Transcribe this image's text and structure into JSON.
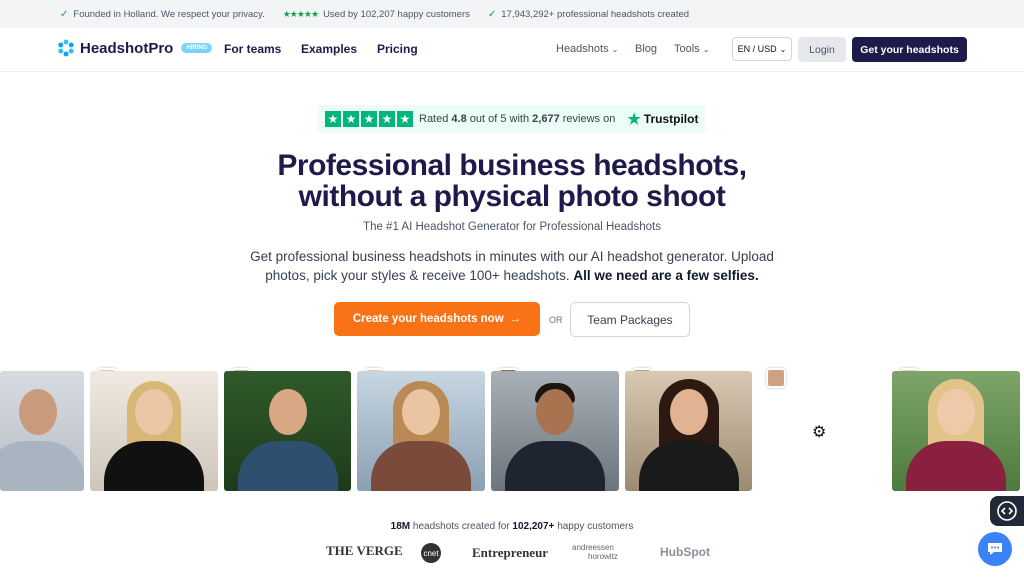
{
  "topbar": {
    "founded": "Founded in Holland. We respect your privacy.",
    "stars": "★★★★★",
    "used_by": "Used by 102,207 happy customers",
    "created": "17,943,292+ professional headshots created"
  },
  "nav": {
    "logo": "HeadshotPro",
    "hiring": "HIRING",
    "for_teams": "For teams",
    "examples": "Examples",
    "pricing": "Pricing",
    "headshots": "Headshots",
    "blog": "Blog",
    "tools": "Tools",
    "lang": "EN / USD",
    "login": "Login",
    "cta": "Get your headshots"
  },
  "trustpilot": {
    "rated": "Rated",
    "score": "4.8",
    "out_of": "out of 5 with",
    "reviews": "2,677",
    "reviews_on": "reviews on",
    "brand": "Trustpilot"
  },
  "hero": {
    "title_line1": "Professional business headshots,",
    "title_line2": "without a physical photo shoot",
    "subtitle": "The #1 AI Headshot Generator for Professional Headshots",
    "desc_line1": "Get professional business headshots in minutes with our AI headshot generator. Upload",
    "desc_line2": "photos, pick your styles & receive 100+ headshots.",
    "desc_bold": "All we need are a few selfies.",
    "cta": "Create your headshots now",
    "or": "OR",
    "team": "Team Packages"
  },
  "stats": {
    "count": "18M",
    "text1": "headshots created for",
    "customers": "102,207+",
    "text2": "happy customers"
  },
  "press": {
    "verge": "THE VERGE",
    "cnet": "cnet",
    "entrepreneur": "Entrepreneur",
    "a16z_1": "andreessen",
    "a16z_2": "horowitz",
    "hubspot": "HubSpot"
  },
  "colors": {
    "navy": "#1e1b4b",
    "orange": "#f97316",
    "trust_green": "#00b67a",
    "chat_blue": "#3b82f6"
  }
}
